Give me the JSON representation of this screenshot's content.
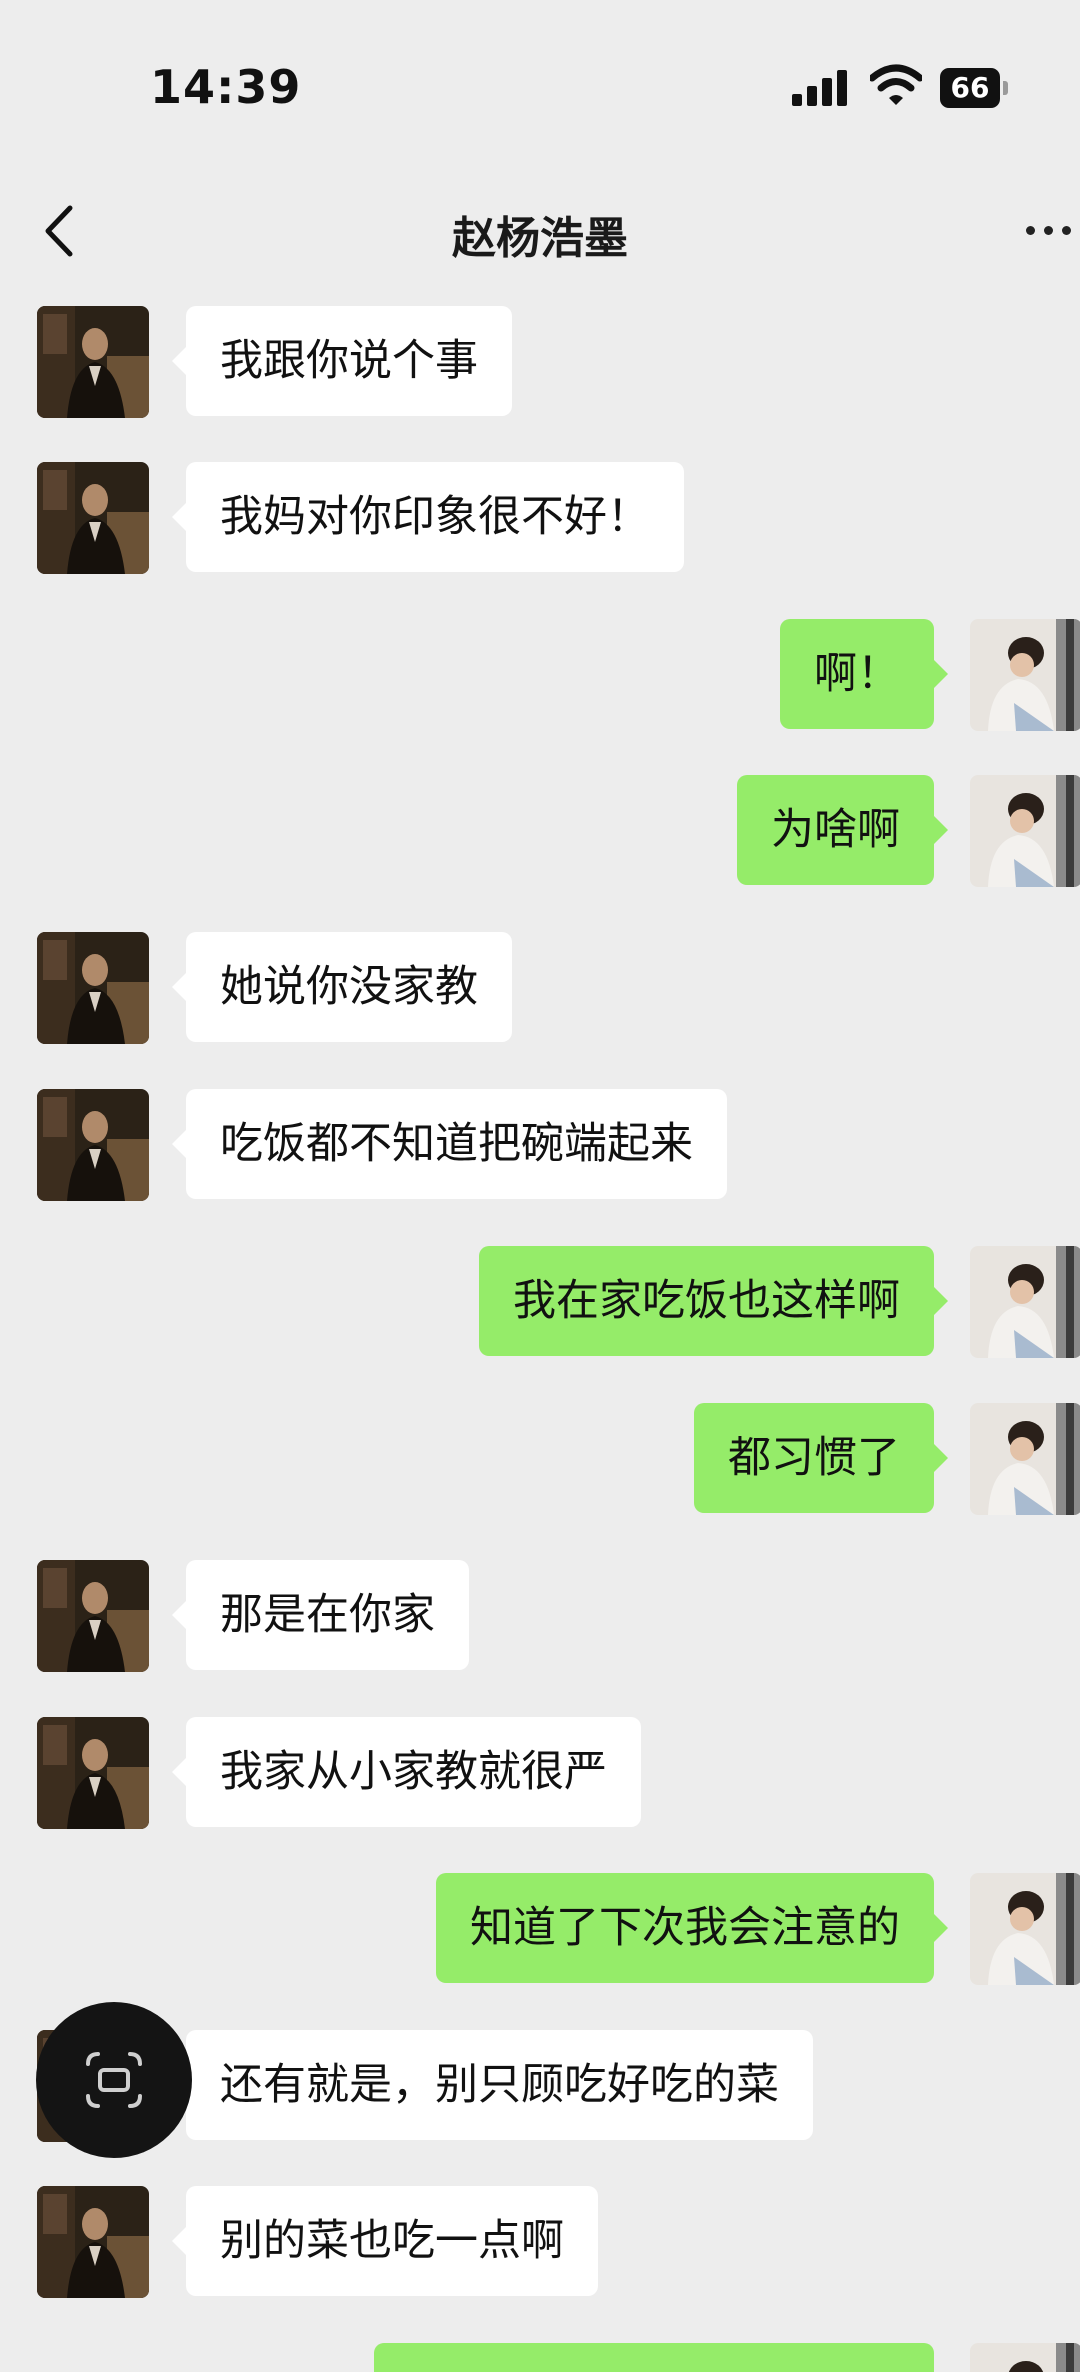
{
  "status_bar": {
    "time": "14:39",
    "battery": "66",
    "icons": [
      "signal-icon",
      "wifi-icon",
      "battery-icon"
    ]
  },
  "nav": {
    "title": "赵杨浩墨",
    "back_icon": "chevron-left-icon",
    "more_icon": "more-dots-icon"
  },
  "colors": {
    "background": "#ededed",
    "incoming_bubble": "#ffffff",
    "outgoing_bubble": "#95ec69"
  },
  "messages": [
    {
      "side": "left",
      "text": "我跟你说个事"
    },
    {
      "side": "left",
      "text": "我妈对你印象很不好！"
    },
    {
      "side": "right",
      "text": "啊！"
    },
    {
      "side": "right",
      "text": "为啥啊"
    },
    {
      "side": "left",
      "text": "她说你没家教"
    },
    {
      "side": "left",
      "text": "吃饭都不知道把碗端起来"
    },
    {
      "side": "right",
      "text": "我在家吃饭也这样啊"
    },
    {
      "side": "right",
      "text": "都习惯了"
    },
    {
      "side": "left",
      "text": "那是在你家"
    },
    {
      "side": "left",
      "text": "我家从小家教就很严"
    },
    {
      "side": "right",
      "text": "知道了下次我会注意的"
    },
    {
      "side": "left",
      "text": "还有就是，别只顾吃好吃的菜"
    },
    {
      "side": "left",
      "text": "别的菜也吃一点啊"
    },
    {
      "side": "right",
      "text": ""
    }
  ],
  "overlay": {
    "icon": "floating-window-icon"
  }
}
